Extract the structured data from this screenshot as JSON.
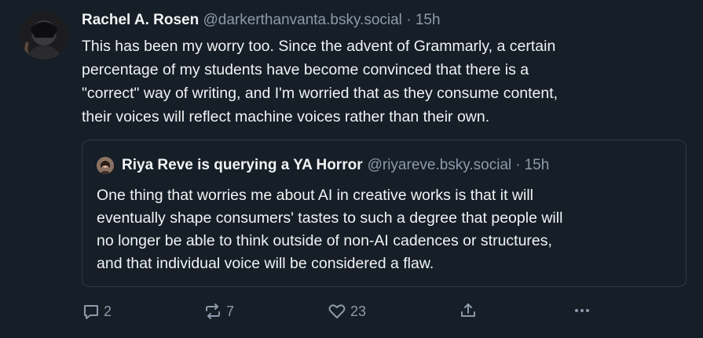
{
  "post": {
    "author_name": "Rachel A. Rosen",
    "author_handle": "@darkerthanvanta.bsky.social",
    "separator": "·",
    "time": "15h",
    "text": "This has been my worry too. Since the advent of Grammarly, a certain\npercentage of my students have become convinced that there is a\n\"correct\" way of writing, and I'm worried that as they consume content,\ntheir voices will reflect machine voices rather than their own."
  },
  "quote": {
    "author_name": "Riya Reve is querying a YA Horror",
    "author_handle": "@riyareve.bsky.social",
    "separator": "·",
    "time": "15h",
    "text": "One thing that worries me about AI in creative works is that it will\neventually shape consumers' tastes to such a degree that people will\nno longer be able to think outside of non-AI cadences or structures,\nand that individual voice will be considered a flaw."
  },
  "actions": {
    "reply_count": "2",
    "repost_count": "7",
    "like_count": "23",
    "icons": [
      "reply-icon",
      "repost-icon",
      "heart-icon",
      "share-icon",
      "more-icon"
    ]
  },
  "colors": {
    "background": "#161e27",
    "text": "#f1f3f5",
    "muted": "#8d9aaa",
    "border": "#2e3a48"
  }
}
